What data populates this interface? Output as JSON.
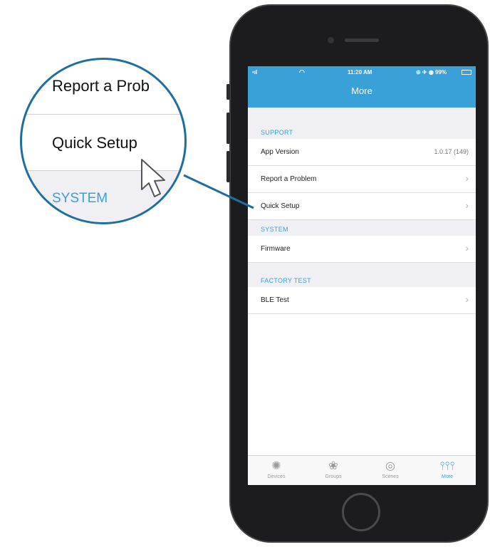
{
  "status_bar": {
    "time": "11:20 AM",
    "battery": "99%"
  },
  "nav": {
    "title": "More"
  },
  "sections": [
    {
      "header": "SUPPORT",
      "rows": [
        {
          "label": "App Version",
          "value": "1.0.17 (149)"
        },
        {
          "label": "Report a Problem"
        },
        {
          "label": "Quick Setup"
        }
      ]
    },
    {
      "header": "SYSTEM",
      "rows": [
        {
          "label": "Firmware"
        }
      ]
    },
    {
      "header": "FACTORY TEST",
      "rows": [
        {
          "label": "BLE Test"
        }
      ]
    }
  ],
  "tabs": [
    {
      "label": "Devices",
      "icon": "gear-icon"
    },
    {
      "label": "Groups",
      "icon": "groups-icon"
    },
    {
      "label": "Scenes",
      "icon": "scenes-icon"
    },
    {
      "label": "More",
      "icon": "sliders-icon",
      "active": true
    }
  ],
  "zoom": {
    "row1": "Report a Prob",
    "row2": "Quick Setup",
    "row3": "SYSTEM"
  },
  "colors": {
    "accent": "#3aa0d8",
    "callout": "#1e6f9f"
  }
}
